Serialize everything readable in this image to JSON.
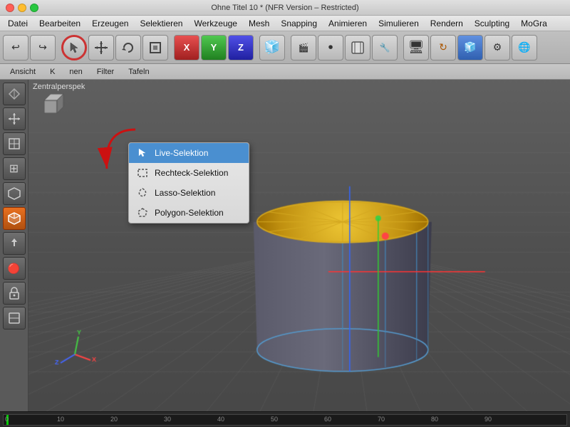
{
  "titlebar": {
    "title": "Ohne Titel 10 * (NFR Version – Restricted)"
  },
  "menubar": {
    "items": [
      "Datei",
      "Bearbeiten",
      "Erzeugen",
      "Selektieren",
      "Werkzeuge",
      "Mesh",
      "Snapping",
      "Animieren",
      "Simulieren",
      "Rendern",
      "Sculpting",
      "MoGra"
    ]
  },
  "tabs": {
    "items": [
      "Ansicht",
      "K",
      "nen",
      "Filter",
      "Tafeln"
    ]
  },
  "viewport": {
    "label": "Zentralperspek"
  },
  "dropdown": {
    "items": [
      {
        "id": "live-selection",
        "label": "Live-Selektion",
        "icon": "cursor"
      },
      {
        "id": "rect-selection",
        "label": "Rechteck-Selektion",
        "icon": "rect"
      },
      {
        "id": "lasso-selection",
        "label": "Lasso-Selektion",
        "icon": "lasso"
      },
      {
        "id": "polygon-selection",
        "label": "Polygon-Selektion",
        "icon": "polygon"
      }
    ]
  },
  "timeline": {
    "start": 0,
    "end": 90,
    "ticks": [
      0,
      10,
      20,
      30,
      40,
      50,
      60,
      70,
      80,
      90
    ]
  },
  "toolbar": {
    "undo_label": "↩",
    "redo_label": "↪"
  }
}
